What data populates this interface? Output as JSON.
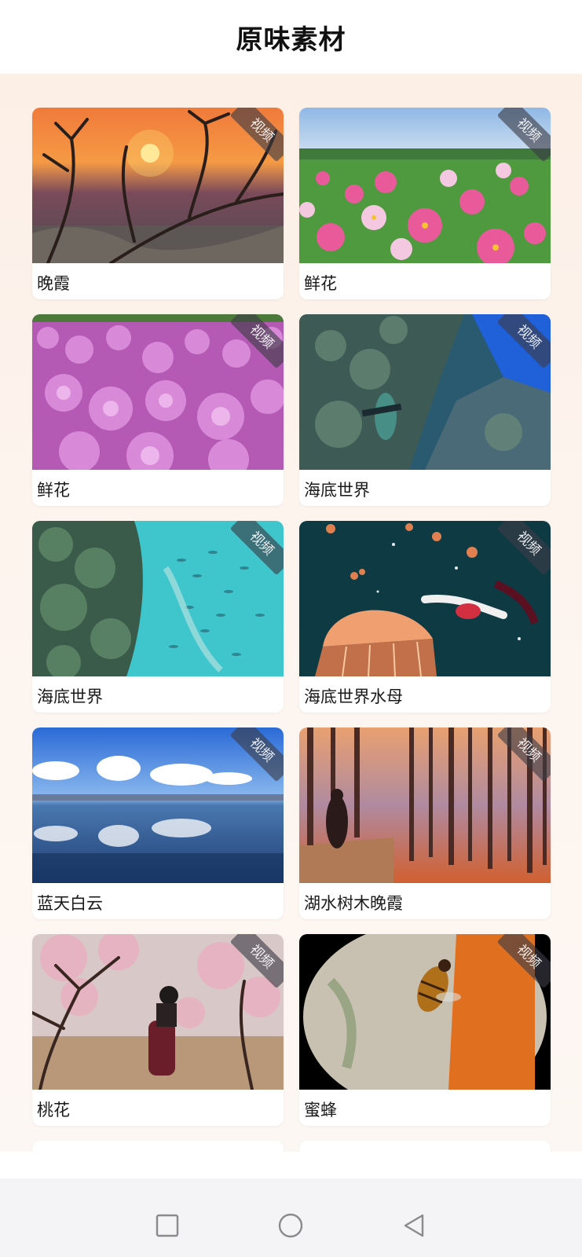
{
  "header": {
    "title": "原味素材"
  },
  "badge_text": "视频",
  "cards": [
    {
      "label": "晚霞",
      "scene": "sunset-branches"
    },
    {
      "label": "鲜花",
      "scene": "cosmos-field"
    },
    {
      "label": "鲜花",
      "scene": "phlox-field"
    },
    {
      "label": "海底世界",
      "scene": "underwater-reef"
    },
    {
      "label": "海底世界",
      "scene": "fish-school"
    },
    {
      "label": "海底世界水母",
      "scene": "jellyfish-diver"
    },
    {
      "label": "蓝天白云",
      "scene": "lake-clouds"
    },
    {
      "label": "湖水树木晚霞",
      "scene": "lake-trees-sunset"
    },
    {
      "label": "桃花",
      "scene": "peach-blossom"
    },
    {
      "label": "蜜蜂",
      "scene": "bee-closeup"
    }
  ],
  "nav": {
    "icons": [
      "square-icon",
      "circle-icon",
      "back-triangle-icon"
    ]
  }
}
